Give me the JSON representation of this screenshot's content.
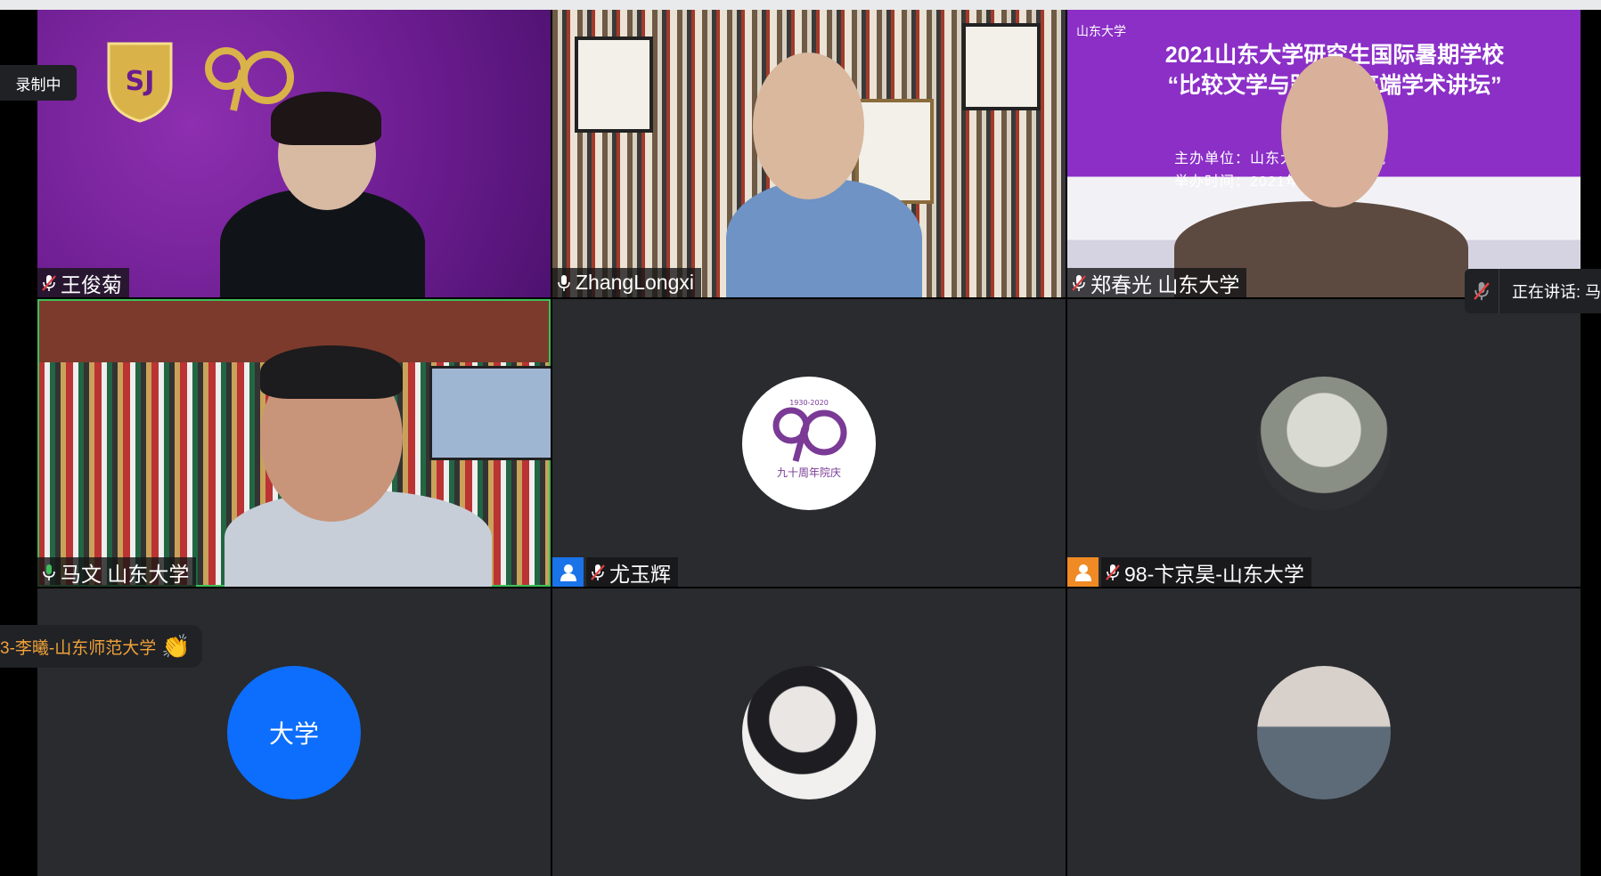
{
  "recording_label": "录制中",
  "speaking": {
    "label": "正在讲话: 马"
  },
  "reaction": {
    "name": "3-李曦-山东师范大学",
    "emoji": "👏"
  },
  "tiles": [
    {
      "name": "王俊菊",
      "mic": "muted"
    },
    {
      "name": "ZhangLongxi",
      "mic": "on"
    },
    {
      "name": "郑春光 山东大学",
      "mic": "muted",
      "banner": {
        "logo_text": "山东大学",
        "title_line1": "2021山东大学研究生国际暑期学校",
        "title_line2": "“比较文学与跨文化高端学术讲坛”",
        "sub_line1": "主办单位：山东大学外国语学院",
        "sub_line2": "举办时间：2021年8月9日"
      }
    },
    {
      "name": "马文 山东大学",
      "mic": "active"
    },
    {
      "name": "尤玉辉",
      "mic": "muted",
      "badge_color": "#1a73e8"
    },
    {
      "name": "98-卞京昊-山东大学",
      "mic": "muted",
      "badge_color": "#f08a24"
    },
    {
      "avatar_text": "大学"
    },
    {
      "avatar": "anime-portrait"
    },
    {
      "avatar": "seagulls-sea"
    }
  ],
  "logo_90": {
    "years": "1930-2020",
    "caption": "九十周年院庆"
  },
  "colors": {
    "tile_bg": "#292b2e",
    "active_border": "#3fbf5a",
    "avatar_blue": "#0d6efd",
    "reaction_text": "#f0a23a"
  }
}
